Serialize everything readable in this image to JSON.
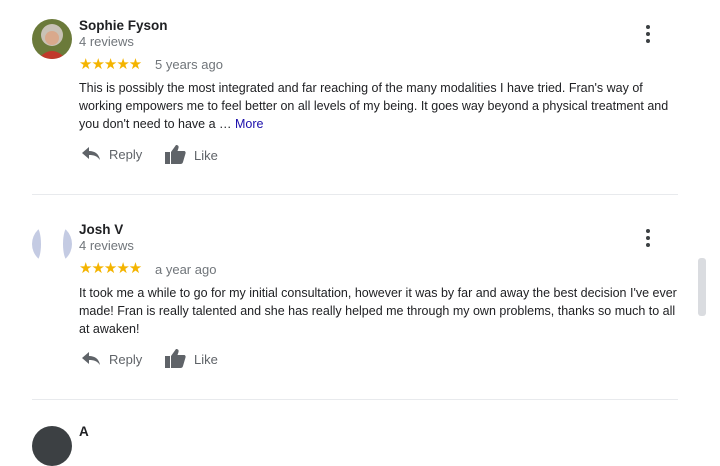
{
  "reviews": [
    {
      "name": "Sophie Fyson",
      "count": "4 reviews",
      "stars": "★★★★★",
      "date": "5 years ago",
      "text": "This is possibly the most integrated and far reaching of the many modalities I have tried.  Fran's way of working empowers me to feel better on all levels of my being.  It goes way beyond a physical treatment and you don't need to have a … ",
      "more": "More",
      "reply": "Reply",
      "like": "Like"
    },
    {
      "name": "Josh V",
      "count": "4 reviews",
      "stars": "★★★★★",
      "date": "a year ago",
      "text": "It took me a while to go for my initial consultation, however it was by far and away the best decision I've ever made! Fran is really talented and she has really helped me through my own problems, thanks so much to all at awaken!",
      "reply": "Reply",
      "like": "Like"
    }
  ],
  "third_review": {
    "name": "A"
  },
  "colors": {
    "star": "#f4b400",
    "link": "#1a0dab",
    "muted": "#70757a"
  }
}
